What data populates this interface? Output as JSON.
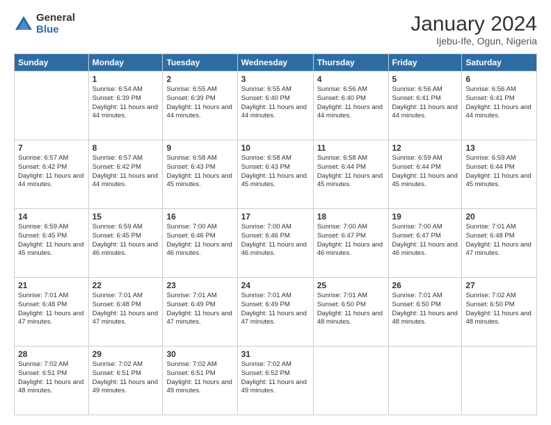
{
  "logo": {
    "general": "General",
    "blue": "Blue"
  },
  "title": "January 2024",
  "location": "Ijebu-Ife, Ogun, Nigeria",
  "days_of_week": [
    "Sunday",
    "Monday",
    "Tuesday",
    "Wednesday",
    "Thursday",
    "Friday",
    "Saturday"
  ],
  "weeks": [
    [
      {
        "num": "",
        "sunrise": "",
        "sunset": "",
        "daylight": ""
      },
      {
        "num": "1",
        "sunrise": "Sunrise: 6:54 AM",
        "sunset": "Sunset: 6:39 PM",
        "daylight": "Daylight: 11 hours and 44 minutes."
      },
      {
        "num": "2",
        "sunrise": "Sunrise: 6:55 AM",
        "sunset": "Sunset: 6:39 PM",
        "daylight": "Daylight: 11 hours and 44 minutes."
      },
      {
        "num": "3",
        "sunrise": "Sunrise: 6:55 AM",
        "sunset": "Sunset: 6:40 PM",
        "daylight": "Daylight: 11 hours and 44 minutes."
      },
      {
        "num": "4",
        "sunrise": "Sunrise: 6:56 AM",
        "sunset": "Sunset: 6:40 PM",
        "daylight": "Daylight: 11 hours and 44 minutes."
      },
      {
        "num": "5",
        "sunrise": "Sunrise: 6:56 AM",
        "sunset": "Sunset: 6:41 PM",
        "daylight": "Daylight: 11 hours and 44 minutes."
      },
      {
        "num": "6",
        "sunrise": "Sunrise: 6:56 AM",
        "sunset": "Sunset: 6:41 PM",
        "daylight": "Daylight: 11 hours and 44 minutes."
      }
    ],
    [
      {
        "num": "7",
        "sunrise": "Sunrise: 6:57 AM",
        "sunset": "Sunset: 6:42 PM",
        "daylight": "Daylight: 11 hours and 44 minutes."
      },
      {
        "num": "8",
        "sunrise": "Sunrise: 6:57 AM",
        "sunset": "Sunset: 6:42 PM",
        "daylight": "Daylight: 11 hours and 44 minutes."
      },
      {
        "num": "9",
        "sunrise": "Sunrise: 6:58 AM",
        "sunset": "Sunset: 6:43 PM",
        "daylight": "Daylight: 11 hours and 45 minutes."
      },
      {
        "num": "10",
        "sunrise": "Sunrise: 6:58 AM",
        "sunset": "Sunset: 6:43 PM",
        "daylight": "Daylight: 11 hours and 45 minutes."
      },
      {
        "num": "11",
        "sunrise": "Sunrise: 6:58 AM",
        "sunset": "Sunset: 6:44 PM",
        "daylight": "Daylight: 11 hours and 45 minutes."
      },
      {
        "num": "12",
        "sunrise": "Sunrise: 6:59 AM",
        "sunset": "Sunset: 6:44 PM",
        "daylight": "Daylight: 11 hours and 45 minutes."
      },
      {
        "num": "13",
        "sunrise": "Sunrise: 6:59 AM",
        "sunset": "Sunset: 6:44 PM",
        "daylight": "Daylight: 11 hours and 45 minutes."
      }
    ],
    [
      {
        "num": "14",
        "sunrise": "Sunrise: 6:59 AM",
        "sunset": "Sunset: 6:45 PM",
        "daylight": "Daylight: 11 hours and 45 minutes."
      },
      {
        "num": "15",
        "sunrise": "Sunrise: 6:59 AM",
        "sunset": "Sunset: 6:45 PM",
        "daylight": "Daylight: 11 hours and 46 minutes."
      },
      {
        "num": "16",
        "sunrise": "Sunrise: 7:00 AM",
        "sunset": "Sunset: 6:46 PM",
        "daylight": "Daylight: 11 hours and 46 minutes."
      },
      {
        "num": "17",
        "sunrise": "Sunrise: 7:00 AM",
        "sunset": "Sunset: 6:46 PM",
        "daylight": "Daylight: 11 hours and 46 minutes."
      },
      {
        "num": "18",
        "sunrise": "Sunrise: 7:00 AM",
        "sunset": "Sunset: 6:47 PM",
        "daylight": "Daylight: 11 hours and 46 minutes."
      },
      {
        "num": "19",
        "sunrise": "Sunrise: 7:00 AM",
        "sunset": "Sunset: 6:47 PM",
        "daylight": "Daylight: 11 hours and 46 minutes."
      },
      {
        "num": "20",
        "sunrise": "Sunrise: 7:01 AM",
        "sunset": "Sunset: 6:48 PM",
        "daylight": "Daylight: 11 hours and 47 minutes."
      }
    ],
    [
      {
        "num": "21",
        "sunrise": "Sunrise: 7:01 AM",
        "sunset": "Sunset: 6:48 PM",
        "daylight": "Daylight: 11 hours and 47 minutes."
      },
      {
        "num": "22",
        "sunrise": "Sunrise: 7:01 AM",
        "sunset": "Sunset: 6:48 PM",
        "daylight": "Daylight: 11 hours and 47 minutes."
      },
      {
        "num": "23",
        "sunrise": "Sunrise: 7:01 AM",
        "sunset": "Sunset: 6:49 PM",
        "daylight": "Daylight: 11 hours and 47 minutes."
      },
      {
        "num": "24",
        "sunrise": "Sunrise: 7:01 AM",
        "sunset": "Sunset: 6:49 PM",
        "daylight": "Daylight: 11 hours and 47 minutes."
      },
      {
        "num": "25",
        "sunrise": "Sunrise: 7:01 AM",
        "sunset": "Sunset: 6:50 PM",
        "daylight": "Daylight: 11 hours and 48 minutes."
      },
      {
        "num": "26",
        "sunrise": "Sunrise: 7:01 AM",
        "sunset": "Sunset: 6:50 PM",
        "daylight": "Daylight: 11 hours and 48 minutes."
      },
      {
        "num": "27",
        "sunrise": "Sunrise: 7:02 AM",
        "sunset": "Sunset: 6:50 PM",
        "daylight": "Daylight: 11 hours and 48 minutes."
      }
    ],
    [
      {
        "num": "28",
        "sunrise": "Sunrise: 7:02 AM",
        "sunset": "Sunset: 6:51 PM",
        "daylight": "Daylight: 11 hours and 48 minutes."
      },
      {
        "num": "29",
        "sunrise": "Sunrise: 7:02 AM",
        "sunset": "Sunset: 6:51 PM",
        "daylight": "Daylight: 11 hours and 49 minutes."
      },
      {
        "num": "30",
        "sunrise": "Sunrise: 7:02 AM",
        "sunset": "Sunset: 6:51 PM",
        "daylight": "Daylight: 11 hours and 49 minutes."
      },
      {
        "num": "31",
        "sunrise": "Sunrise: 7:02 AM",
        "sunset": "Sunset: 6:52 PM",
        "daylight": "Daylight: 11 hours and 49 minutes."
      },
      {
        "num": "",
        "sunrise": "",
        "sunset": "",
        "daylight": ""
      },
      {
        "num": "",
        "sunrise": "",
        "sunset": "",
        "daylight": ""
      },
      {
        "num": "",
        "sunrise": "",
        "sunset": "",
        "daylight": ""
      }
    ]
  ],
  "accent_color": "#2e6da4"
}
